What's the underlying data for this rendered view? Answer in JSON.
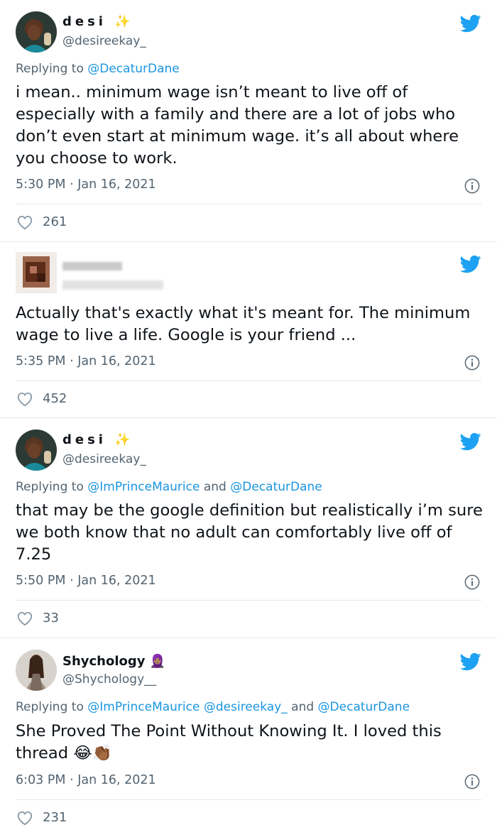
{
  "colors": {
    "twitter_blue": "#1da1f2",
    "mention_blue": "#1b95e0",
    "text": "#0f1419",
    "muted": "#536471",
    "divider": "#e1e8ed"
  },
  "icons": {
    "brand": "twitter-bird-icon",
    "info": "info-circle-icon",
    "like": "heart-outline-icon"
  },
  "tweets": [
    {
      "name": "desi ✨",
      "handle": "@desireekay_",
      "reply_prefix": "Replying to",
      "reply_mentions": [
        "@DecaturDane"
      ],
      "text": "i mean.. minimum wage isn’t meant to live off of especially with a family and there are a lot of jobs who don’t even start at minimum wage. it’s all about where you choose to work.",
      "timestamp": "5:30 PM · Jan 16, 2021",
      "likes": "261"
    },
    {
      "name": "",
      "handle": "",
      "text": "Actually that's exactly what it's meant for. The minimum wage to live a life. Google is your friend ...",
      "timestamp": "5:35 PM · Jan 16, 2021",
      "likes": "452"
    },
    {
      "name": "desi ✨",
      "handle": "@desireekay_",
      "reply_prefix": "Replying to",
      "reply_mentions": [
        "@ImPrinceMaurice",
        "and",
        "@DecaturDane"
      ],
      "text": "that may be the google definition but realistically i’m sure we both know that no adult can comfortably live off of 7.25",
      "timestamp": "5:50 PM · Jan 16, 2021",
      "likes": "33"
    },
    {
      "name": "Shychology 🧕🏽",
      "handle": "@Shychology__",
      "reply_prefix": "Replying to",
      "reply_mentions": [
        "@ImPrinceMaurice",
        "@desireekay_",
        "and",
        "@DecaturDane"
      ],
      "text": "She Proved The Point Without Knowing It. I loved this thread 😂👏🏾",
      "timestamp": "6:03 PM · Jan 16, 2021",
      "likes": "231"
    }
  ]
}
